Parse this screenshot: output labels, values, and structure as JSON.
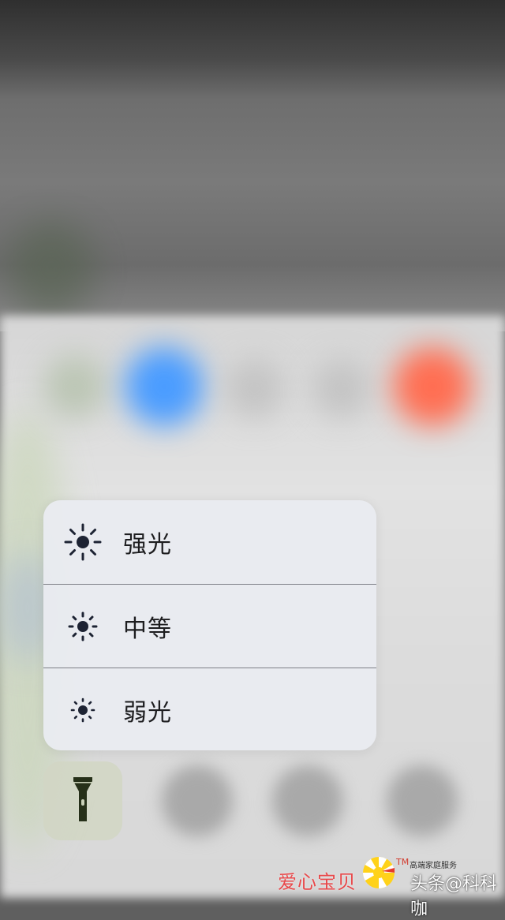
{
  "menu": {
    "items": [
      {
        "label": "强光",
        "icon": "sun-large-icon"
      },
      {
        "label": "中等",
        "icon": "sun-medium-icon"
      },
      {
        "label": "弱光",
        "icon": "sun-small-icon"
      }
    ]
  },
  "flashlight": {
    "icon": "flashlight-icon"
  },
  "background_colors": {
    "blue_toggle": "#4a9cff",
    "orange_toggle": "#ff6e52",
    "panel": "#dcdcdc"
  },
  "watermark": {
    "left_text": "爱心宝贝",
    "tm": "TM",
    "service_text": "高端家庭服务",
    "right_text": "头条@科科咖"
  }
}
